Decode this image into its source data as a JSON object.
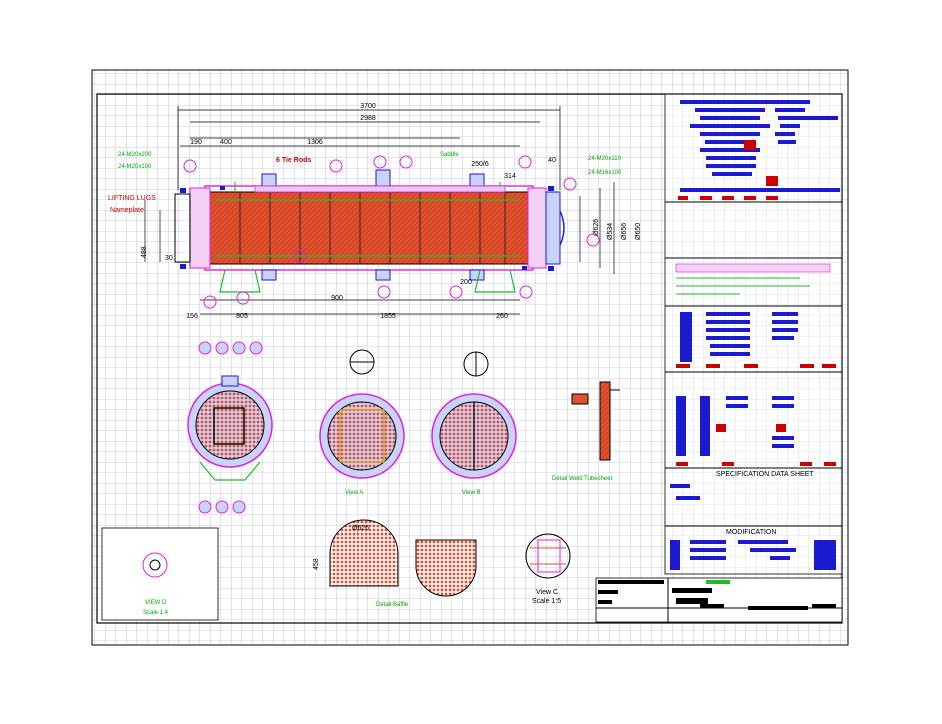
{
  "colors": {
    "frame": "#000000",
    "grid": "#9aa7c8",
    "tube": "#e0502c",
    "magenta": "#e020e0",
    "green": "#22bb22",
    "blue": "#1a1ad0",
    "dim_text": "#00a000",
    "note_red": "#cc0000"
  },
  "dimensions": {
    "overall": "3700",
    "shell": "2988",
    "d_400": "400",
    "d_1306": "1306",
    "d_190": "190",
    "d_40": "40",
    "d_250": "250/6",
    "d_314": "314",
    "d_900": "900",
    "d_1855": "1855",
    "d_805": "805",
    "d_260": "260",
    "d_200": "200",
    "d_156": "156",
    "d_488": "488",
    "d_30": "30",
    "d_534": "Ø534",
    "d_656": "Ø656",
    "d_650": "Ø650",
    "d_625": "Ø626"
  },
  "labels": {
    "tie_rods": "6 Tie Rods",
    "lifting_lugs": "LIFTING LUGS",
    "nameplate": "Nameplate",
    "nozzle_tl1": "24-M20x200",
    "nozzle_tl2": "24-M20x100",
    "nozzle_tr1": "24-M20x110",
    "nozzle_tr2": "24-M16x100",
    "saddle": "Saddle",
    "view_a": "View A",
    "view_b": "View B",
    "view_c": "View C",
    "scale_c": "Scale 1:5",
    "view_d": "VIEW D",
    "scale_d": "Scale 1:4",
    "detail_baffle": "Detail Baffle",
    "detail_weld": "Detail Weld Tubesheet",
    "spec_sheet": "SPECIFICATION DATA SHEET",
    "modification": "MODIFICATION",
    "dia_626": "Ø626",
    "d_458": "458"
  }
}
